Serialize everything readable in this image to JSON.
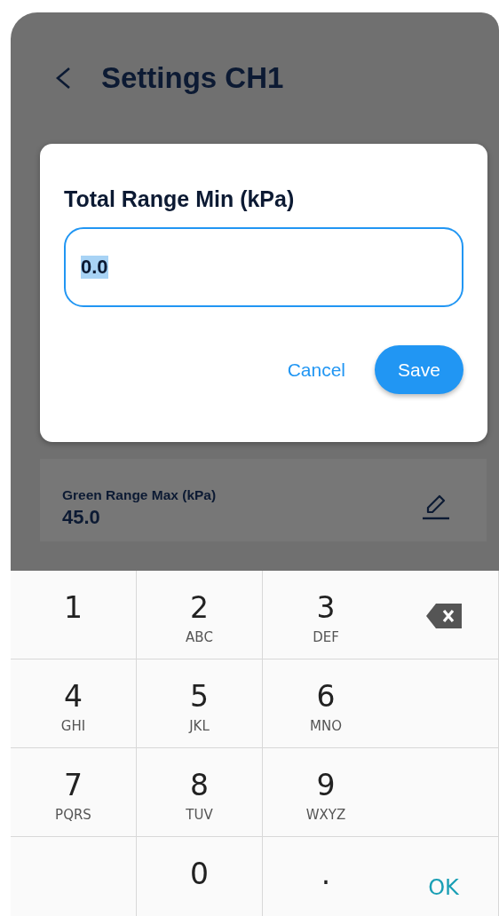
{
  "header": {
    "title": "Settings CH1"
  },
  "dialog": {
    "title": "Total Range Min (kPa)",
    "field": {
      "value": "0.0",
      "text_selected": true,
      "focused": true
    },
    "buttons": [
      {
        "label": "Cancel",
        "kind": "text"
      },
      {
        "label": "Save",
        "kind": "filled"
      }
    ]
  },
  "setting_card": {
    "label": "Green Range Max (kPa)",
    "value": "45.0"
  },
  "keypad": {
    "keys": [
      {
        "kind": "digit",
        "main": "1"
      },
      {
        "kind": "digit",
        "main": "2",
        "letters": "ABC"
      },
      {
        "kind": "digit",
        "main": "3",
        "letters": "DEF"
      },
      {
        "kind": "backspace"
      },
      {
        "kind": "digit",
        "main": "4",
        "letters": "GHI"
      },
      {
        "kind": "digit",
        "main": "5",
        "letters": "JKL"
      },
      {
        "kind": "digit",
        "main": "6",
        "letters": "MNO"
      },
      {
        "kind": "blank"
      },
      {
        "kind": "digit",
        "main": "7",
        "letters": "PQRS"
      },
      {
        "kind": "digit",
        "main": "8",
        "letters": "TUV"
      },
      {
        "kind": "digit",
        "main": "9",
        "letters": "WXYZ"
      },
      {
        "kind": "blank"
      },
      {
        "kind": "blank"
      },
      {
        "kind": "digit",
        "main": "0"
      },
      {
        "kind": "digit",
        "main": "."
      },
      {
        "kind": "ok",
        "main": "OK"
      }
    ]
  }
}
